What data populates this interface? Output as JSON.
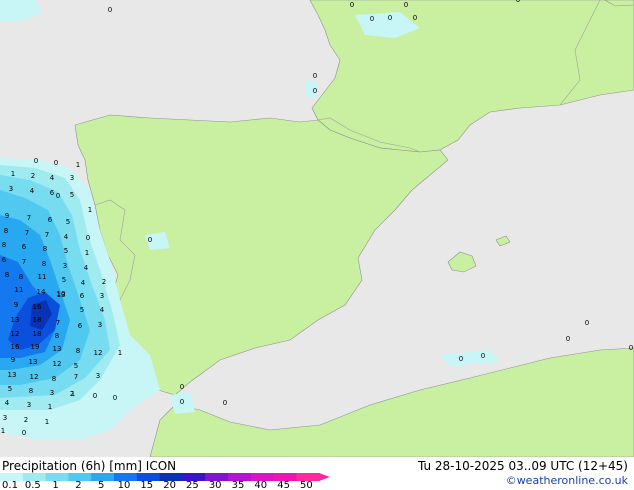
{
  "title": "Precipitation (6h) [mm] ICON",
  "valid_time": "Tu 28-10-2025 03..09 UTC (12+45)",
  "credit": "©weatheronline.co.uk",
  "colors": {
    "sea": "#e8e8e8",
    "land": "#c8f0a0",
    "border": "#a0a0a0",
    "coast": "#909090"
  },
  "legend": {
    "ticks": [
      "0.1",
      "0.5",
      "1",
      "2",
      "5",
      "10",
      "15",
      "20",
      "25",
      "30",
      "35",
      "40",
      "45",
      "50"
    ],
    "colors": [
      "#c8f5f5",
      "#a0ebf0",
      "#78dcf0",
      "#50c8f0",
      "#28a8f0",
      "#1478f0",
      "#0a50dc",
      "#0a32b4",
      "#3c14c8",
      "#8214d2",
      "#b414d2",
      "#dc14c8",
      "#f014b4",
      "#ff28a0"
    ]
  },
  "map_values": [
    {
      "v": "1"
    },
    {
      "v": "2"
    },
    {
      "v": "4"
    },
    {
      "v": "3"
    },
    {
      "v": "0"
    },
    {
      "v": "0"
    },
    {
      "v": "3"
    },
    {
      "v": "4"
    },
    {
      "v": "6"
    },
    {
      "v": "5"
    },
    {
      "v": "1"
    },
    {
      "v": "9"
    },
    {
      "v": "7"
    },
    {
      "v": "6"
    },
    {
      "v": "5"
    },
    {
      "v": "1"
    },
    {
      "v": "8"
    },
    {
      "v": "7"
    },
    {
      "v": "7"
    },
    {
      "v": "4"
    },
    {
      "v": "8"
    },
    {
      "v": "6"
    },
    {
      "v": "8"
    },
    {
      "v": "5"
    },
    {
      "v": "6"
    },
    {
      "v": "7"
    },
    {
      "v": "8"
    },
    {
      "v": "3"
    },
    {
      "v": "1"
    },
    {
      "v": "0"
    },
    {
      "v": "8"
    },
    {
      "v": "8"
    },
    {
      "v": "11"
    },
    {
      "v": "5"
    },
    {
      "v": "4"
    },
    {
      "v": "11"
    },
    {
      "v": "14"
    },
    {
      "v": "10"
    },
    {
      "v": "4"
    },
    {
      "v": "2"
    },
    {
      "v": "9"
    },
    {
      "v": "16"
    },
    {
      "v": "13"
    },
    {
      "v": "6"
    },
    {
      "v": "3"
    },
    {
      "v": "13"
    },
    {
      "v": "18"
    },
    {
      "v": "7"
    },
    {
      "v": "5"
    },
    {
      "v": "4"
    },
    {
      "v": "12"
    },
    {
      "v": "18"
    },
    {
      "v": "8"
    },
    {
      "v": "6"
    },
    {
      "v": "3"
    },
    {
      "v": "16"
    },
    {
      "v": "19"
    },
    {
      "v": "13"
    },
    {
      "v": "8"
    },
    {
      "v": "1"
    },
    {
      "v": "9"
    },
    {
      "v": "13"
    },
    {
      "v": "12"
    },
    {
      "v": "5"
    },
    {
      "v": "12"
    },
    {
      "v": "13"
    },
    {
      "v": "12"
    },
    {
      "v": "8"
    },
    {
      "v": "7"
    },
    {
      "v": "3"
    },
    {
      "v": "5"
    },
    {
      "v": "8"
    },
    {
      "v": "3"
    },
    {
      "v": "2"
    },
    {
      "v": "4"
    },
    {
      "v": "3"
    },
    {
      "v": "1"
    },
    {
      "v": "1"
    },
    {
      "v": "0"
    },
    {
      "v": "3"
    },
    {
      "v": "2"
    },
    {
      "v": "1"
    },
    {
      "v": "1"
    },
    {
      "v": "0"
    },
    {
      "v": "0"
    },
    {
      "v": "0"
    },
    {
      "v": "0"
    },
    {
      "v": "0"
    },
    {
      "v": "0"
    },
    {
      "v": "0"
    },
    {
      "v": "0"
    },
    {
      "v": "0"
    },
    {
      "v": "0"
    },
    {
      "v": "0"
    },
    {
      "v": "0"
    },
    {
      "v": "0"
    },
    {
      "v": "0"
    },
    {
      "v": "0"
    },
    {
      "v": "0"
    },
    {
      "v": "0"
    },
    {
      "v": "0"
    },
    {
      "v": "0"
    },
    {
      "v": "0"
    },
    {
      "v": "0"
    }
  ]
}
